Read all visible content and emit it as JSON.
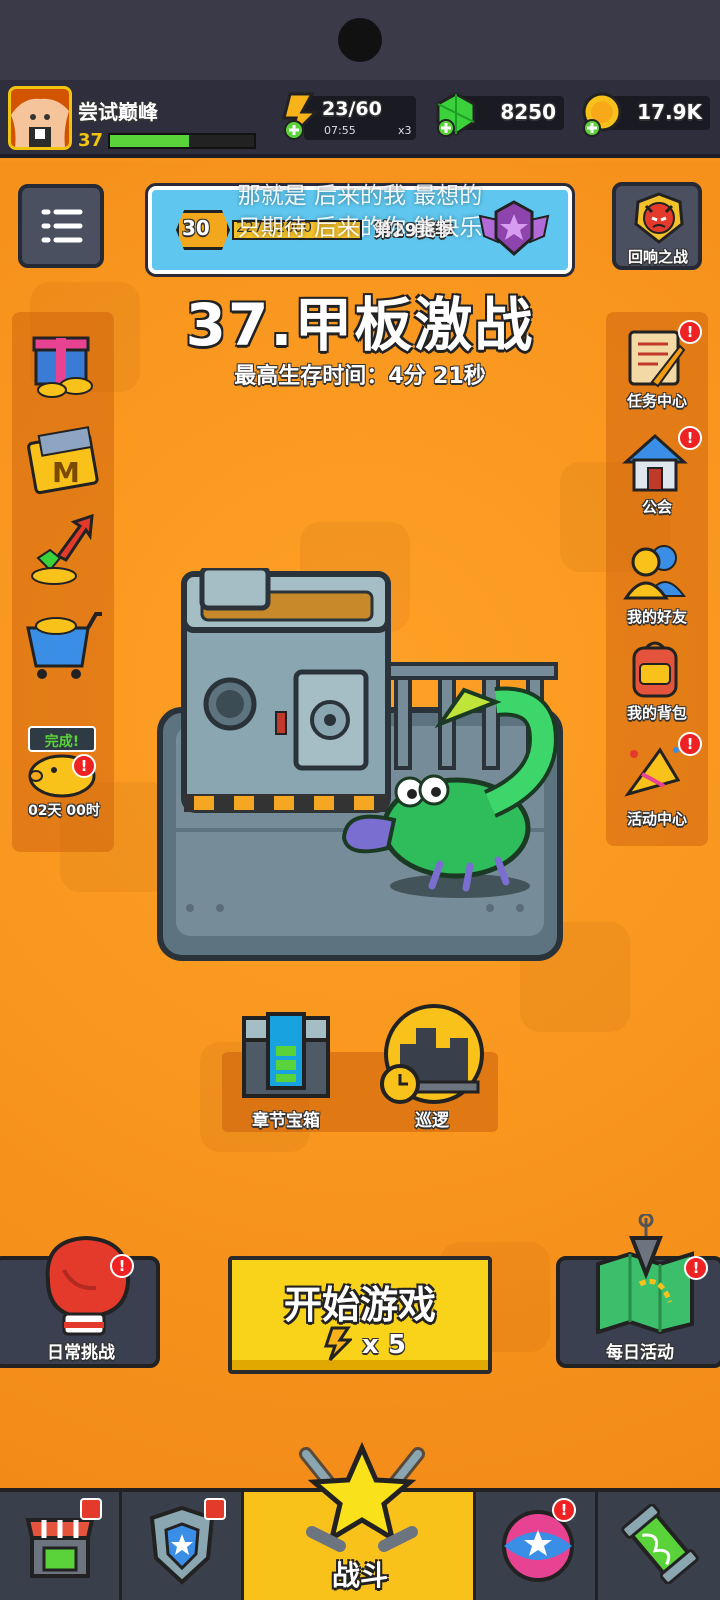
{
  "player": {
    "name": "尝试巅峰",
    "level": "37",
    "xp_progress": 0.55
  },
  "resources": {
    "energy": {
      "value": "23/60",
      "timer": "07:55",
      "multiplier": "x3"
    },
    "gems": {
      "value": "8250"
    },
    "coins": {
      "value": "17.9K"
    }
  },
  "season": {
    "level": "30",
    "progress": "2275/2000",
    "label": "第29赛季",
    "lyrics_line1": "那就是 后来的我 最想的",
    "lyrics_line2": "只期待 后来的你 能快乐"
  },
  "stage": {
    "title": "37.甲板激战",
    "best_survival": "最高生存时间：4分 21秒"
  },
  "echo_battle": {
    "label": "回响之战"
  },
  "left_sidebar": {
    "piggy_bank": {
      "badge": "完成!",
      "timer": "02天 00时"
    }
  },
  "right_sidebar": {
    "items": [
      {
        "label": "任务中心"
      },
      {
        "label": "公会"
      },
      {
        "label": "我的好友"
      },
      {
        "label": "我的背包"
      },
      {
        "label": "活动中心"
      }
    ]
  },
  "actions": {
    "chapter_chest": "章节宝箱",
    "patrol": "巡逻",
    "daily_challenge": "日常挑战",
    "daily_activity": "每日活动",
    "start_game": "开始游戏",
    "start_cost": "x 5"
  },
  "bottom_nav": {
    "battle": "战斗"
  },
  "colors": {
    "background": "#f7941d",
    "start_button": "#f9d21a",
    "xp_bar": "#5ad33a",
    "notification": "#e22222"
  }
}
